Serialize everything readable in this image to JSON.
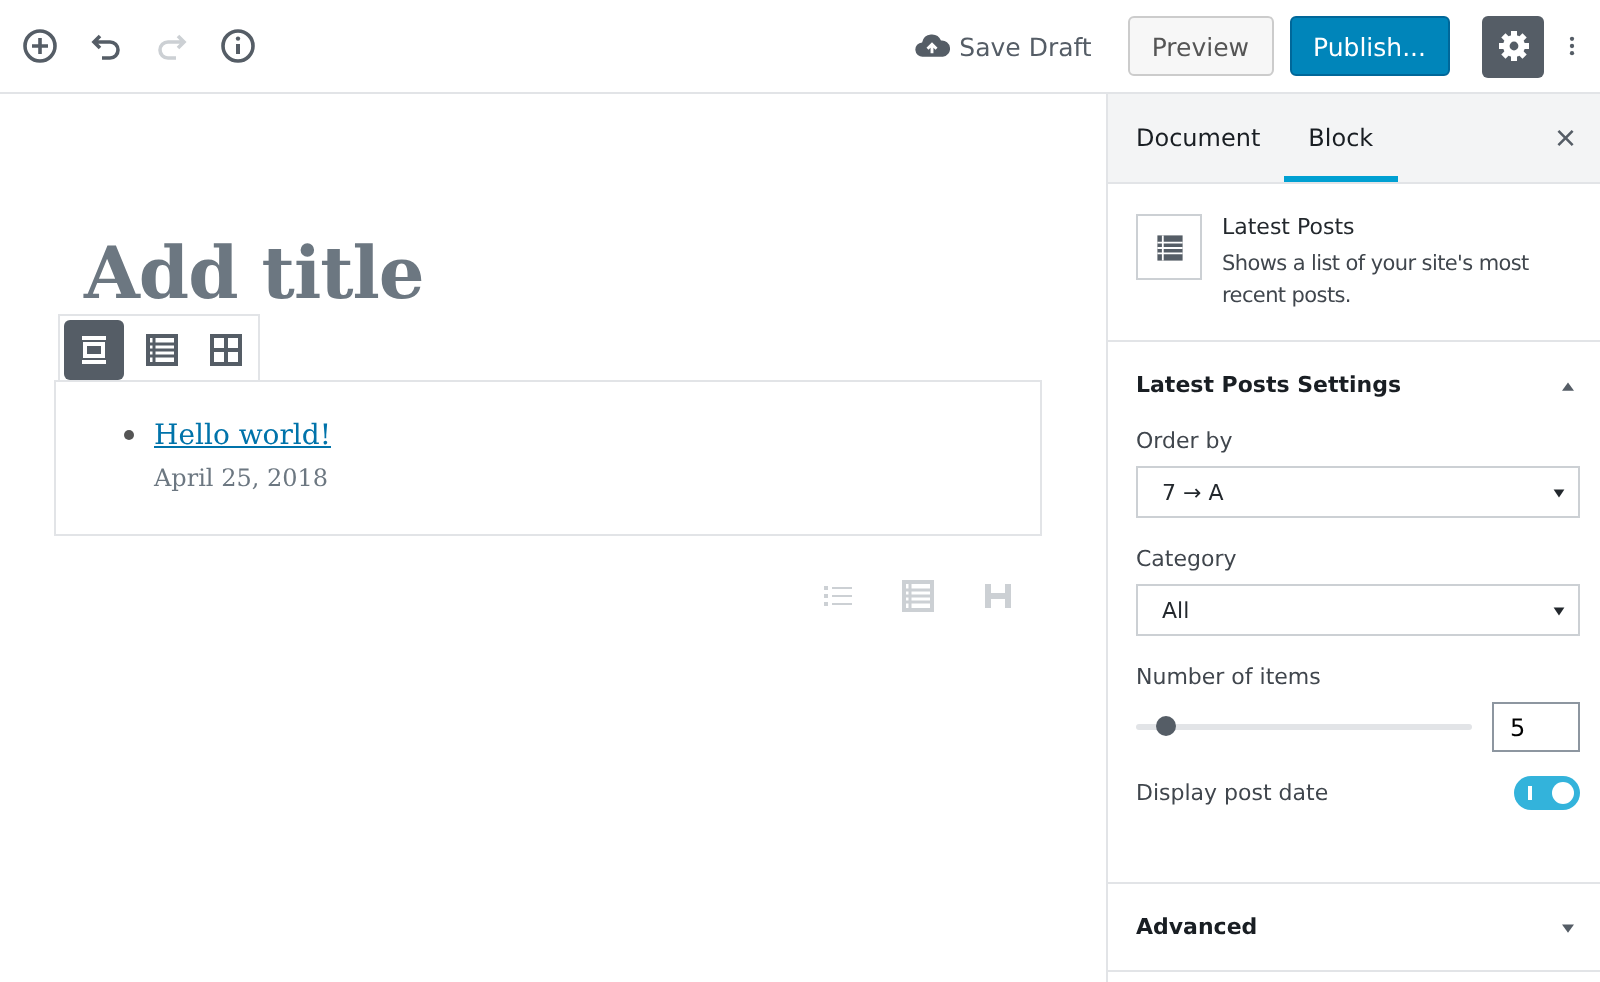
{
  "header": {
    "undo_disabled": false,
    "redo_disabled": true,
    "save_draft": "Save Draft",
    "preview": "Preview",
    "publish": "Publish...",
    "settings_open": true
  },
  "editor": {
    "title_placeholder": "Add title",
    "block_toolbar": [
      {
        "kind": "list",
        "selected": true
      },
      {
        "kind": "table",
        "selected": false
      },
      {
        "kind": "grid",
        "selected": false
      }
    ],
    "posts": [
      {
        "title": "Hello world!",
        "date": "April 25, 2018"
      }
    ]
  },
  "sidebar": {
    "tabs": [
      {
        "label": "Document",
        "selected": false
      },
      {
        "label": "Block",
        "selected": true
      }
    ],
    "close": "×",
    "block": {
      "name": "Latest Posts",
      "description": "Shows a list of your site's most recent posts."
    },
    "panels": [
      {
        "title": "Latest Posts Settings",
        "expanded": true,
        "fields": [
          {
            "kind": "select",
            "label": "Order by",
            "value": "7 → A"
          },
          {
            "kind": "select",
            "label": "Category",
            "value": "All"
          },
          {
            "kind": "range",
            "label": "Number of items",
            "level": 0.08,
            "value": "5"
          },
          {
            "kind": "toggle",
            "label": "Display post date",
            "on": true
          }
        ]
      },
      {
        "title": "Advanced",
        "expanded": false
      }
    ]
  }
}
